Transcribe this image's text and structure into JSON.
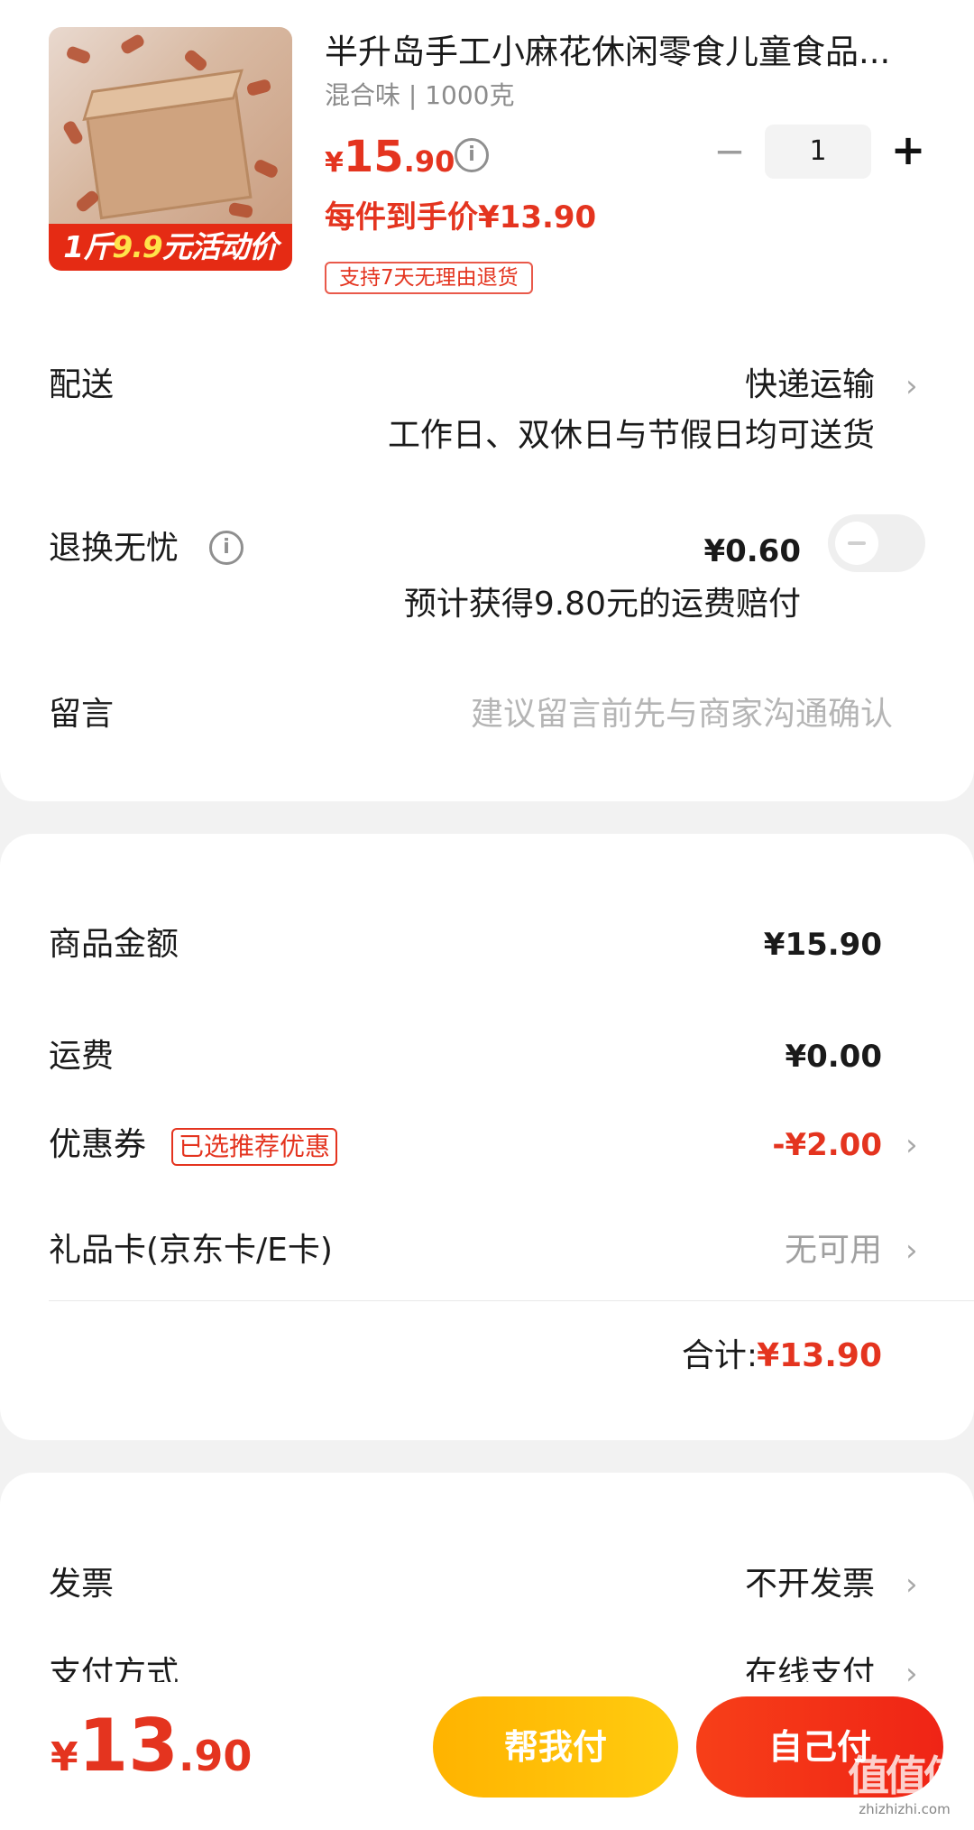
{
  "product": {
    "name": "半升岛手工小麻花休闲零食儿童食品...",
    "spec": "混合味 | 1000克",
    "image_promo": {
      "prefix": "1斤",
      "highlight": "9.9",
      "suffix": "元活动价"
    },
    "price": {
      "symbol": "¥",
      "integer": "15",
      "decimal": ".90"
    },
    "deal_price_text": "每件到手价¥13.90",
    "return_tag": "支持7天无理由退货",
    "quantity": {
      "minus": "−",
      "value": "1",
      "plus": "+"
    }
  },
  "delivery": {
    "label": "配送",
    "method": "快递运输",
    "note": "工作日、双休日与节假日均可送货"
  },
  "return_insurance": {
    "label": "退换无忧",
    "price": "¥0.60",
    "note": "预计获得9.80元的运费赔付",
    "enabled": false
  },
  "message": {
    "label": "留言",
    "placeholder": "建议留言前先与商家沟通确认"
  },
  "amounts": {
    "goods_label": "商品金额",
    "goods_value": "¥15.90",
    "shipping_label": "运费",
    "shipping_value": "¥0.00",
    "coupon_label": "优惠券",
    "coupon_badge": "已选推荐优惠",
    "coupon_value": "-¥2.00",
    "giftcard_label": "礼品卡(京东卡/E卡)",
    "giftcard_value": "无可用",
    "total_label": "合计:",
    "total_value": "¥13.90"
  },
  "invoice": {
    "label": "发票",
    "value": "不开发票"
  },
  "payment": {
    "label": "支付方式",
    "value": "在线支付"
  },
  "bottom": {
    "price": {
      "symbol": "¥",
      "integer": "13",
      "decimal": ".90"
    },
    "help_pay_label": "帮我付",
    "self_pay_label": "自己付"
  },
  "watermark": {
    "mark": "值值值",
    "site": "zhizhizhi.com"
  },
  "icons": {
    "info": "info-icon",
    "chevron": "chevron-right-icon"
  },
  "colors": {
    "accent_red": "#e4341f",
    "help_button": "#ffbf00",
    "self_button": "#f2301a"
  }
}
